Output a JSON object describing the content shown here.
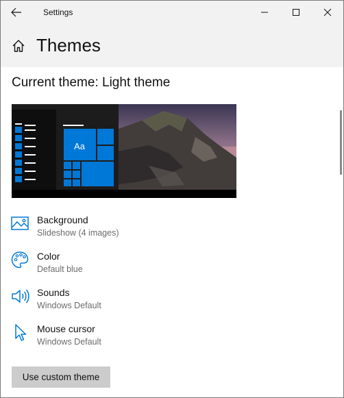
{
  "window": {
    "title": "Settings"
  },
  "header": {
    "title": "Themes"
  },
  "current_theme": {
    "label": "Current theme:",
    "value": "Light theme"
  },
  "preview": {
    "tile_text": "Aa"
  },
  "settings": [
    {
      "name": "Background",
      "value": "Slideshow (4 images)",
      "icon": "picture-icon"
    },
    {
      "name": "Color",
      "value": "Default blue",
      "icon": "palette-icon"
    },
    {
      "name": "Sounds",
      "value": "Windows Default",
      "icon": "speaker-icon"
    },
    {
      "name": "Mouse cursor",
      "value": "Windows Default",
      "icon": "cursor-icon"
    }
  ],
  "buttons": {
    "use_custom_theme": "Use custom theme"
  },
  "colors": {
    "accent": "#0078d7",
    "titlebar_bg": "#f2f2f2",
    "button_bg": "#cccccc"
  }
}
